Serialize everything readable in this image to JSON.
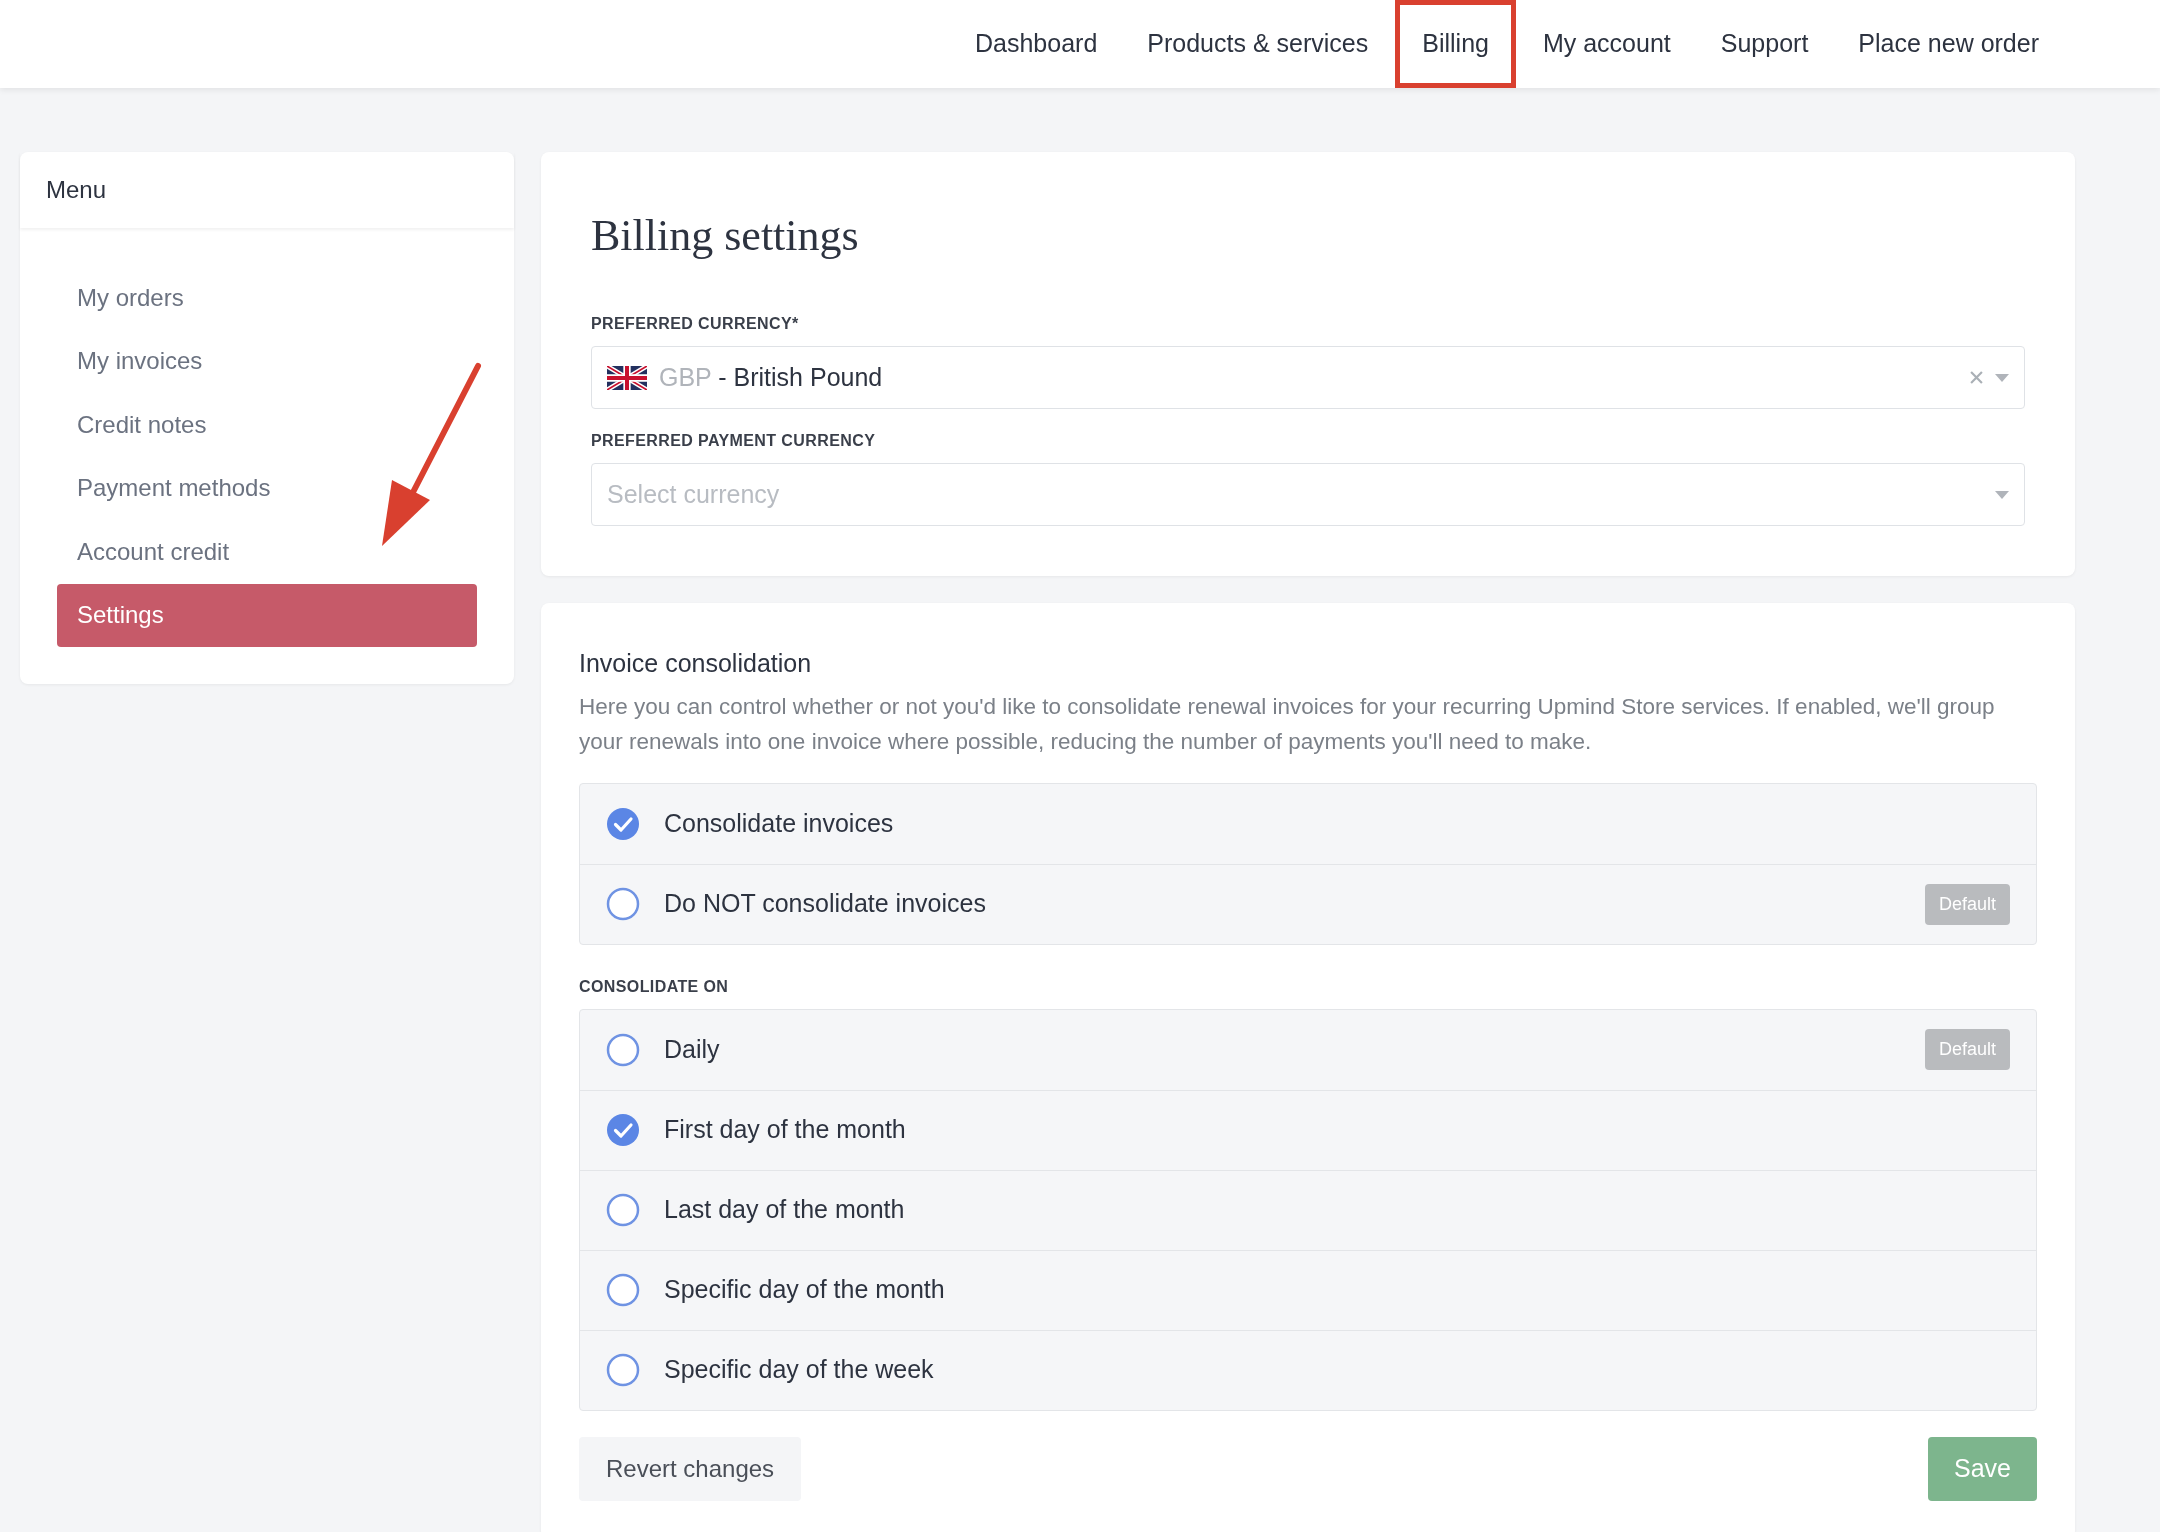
{
  "nav": [
    {
      "label": "Dashboard",
      "highlighted": false
    },
    {
      "label": "Products & services",
      "highlighted": false
    },
    {
      "label": "Billing",
      "highlighted": true
    },
    {
      "label": "My account",
      "highlighted": false
    },
    {
      "label": "Support",
      "highlighted": false
    },
    {
      "label": "Place new order",
      "highlighted": false
    }
  ],
  "sidebar": {
    "title": "Menu",
    "arrow_annotation": true,
    "items": [
      {
        "label": "My orders",
        "selected": false
      },
      {
        "label": "My invoices",
        "selected": false
      },
      {
        "label": "Credit notes",
        "selected": false
      },
      {
        "label": "Payment methods",
        "selected": false
      },
      {
        "label": "Account credit",
        "selected": false
      },
      {
        "label": "Settings",
        "selected": true
      }
    ]
  },
  "billing_settings": {
    "title": "Billing settings",
    "fields": [
      {
        "label": "PREFERRED CURRENCY*",
        "code": "GBP",
        "value": "- British Pound",
        "clearable": true
      },
      {
        "label": "PREFERRED PAYMENT CURRENCY",
        "placeholder": "Select currency",
        "clearable": false
      }
    ]
  },
  "invoice_consolidation": {
    "title": "Invoice consolidation",
    "description": "Here you can control whether or not you'd like to consolidate renewal invoices for your recurring Upmind Store services. If enabled, we'll group your renewals into one invoice where possible, reducing the number of payments you'll need to make.",
    "options": [
      {
        "label": "Consolidate invoices",
        "selected": true
      },
      {
        "label": "Do NOT consolidate invoices",
        "selected": false,
        "badge": "Default"
      }
    ],
    "consolidate_on": {
      "label": "CONSOLIDATE ON",
      "options": [
        {
          "label": "Daily",
          "selected": false,
          "badge": "Default"
        },
        {
          "label": "First day of the month",
          "selected": true
        },
        {
          "label": "Last day of the month",
          "selected": false
        },
        {
          "label": "Specific day of the month",
          "selected": false
        },
        {
          "label": "Specific day of the week",
          "selected": false
        }
      ]
    },
    "buttons": {
      "revert": "Revert changes",
      "save": "Save"
    }
  }
}
